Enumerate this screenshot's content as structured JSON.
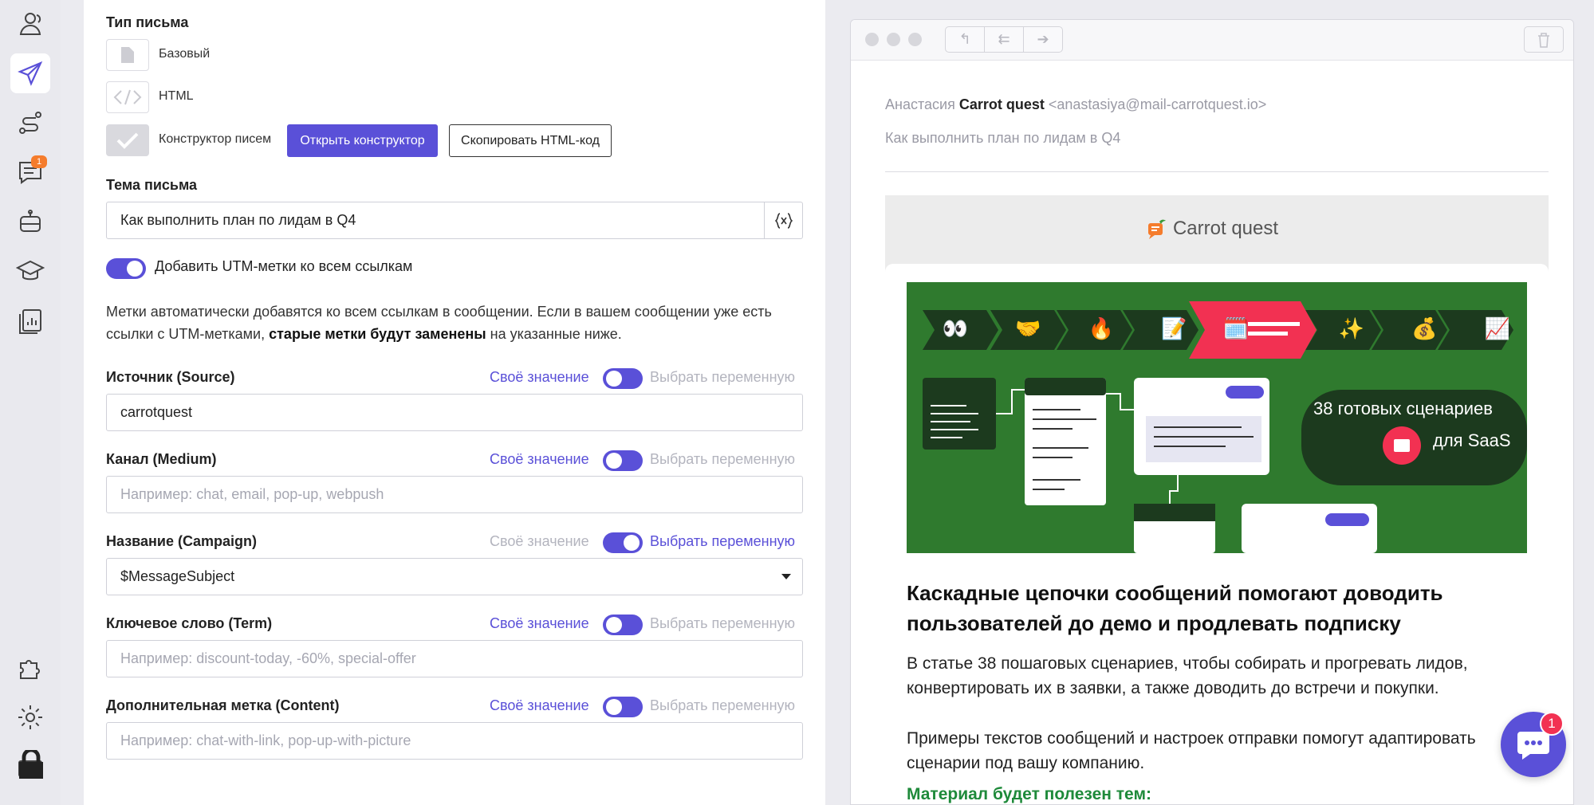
{
  "sidebar": {
    "messages_badge": "1"
  },
  "form": {
    "type_label": "Тип письма",
    "type_basic": "Базовый",
    "type_html": "HTML",
    "type_builder": "Конструктор писем",
    "open_builder": "Открыть конструктор",
    "copy_html": "Скопировать HTML-код",
    "subject_label": "Тема письма",
    "subject_value": "Как выполнить план по лидам в Q4",
    "utm_toggle_label": "Добавить UTM-метки ко всем ссылкам",
    "desc_part1": "Метки автоматически добавятся ко всем ссылкам в сообщении. Если в вашем сообщении уже есть ссылки с UTM-метками, ",
    "desc_bold": "старые метки будут заменены",
    "desc_part2": " на указанные ниже.",
    "own_value": "Своё значение",
    "choose_var": "Выбрать переменную",
    "source_label": "Источник (Source)",
    "source_value": "carrotquest",
    "medium_label": "Канал (Medium)",
    "medium_placeholder": "Например: chat, email, pop-up, webpush",
    "campaign_label": "Название (Campaign)",
    "campaign_value": "$MessageSubject",
    "term_label": "Ключевое слово (Term)",
    "term_placeholder": "Например: discount-today, -60%, special-offer",
    "content_label": "Дополнительная метка (Content)",
    "content_placeholder": "Например: chat-with-link, pop-up-with-picture"
  },
  "preview": {
    "from_first": "Анастасия",
    "from_last": "Carrot quest",
    "from_email": "<anastasiya@mail-carrotquest.io>",
    "subject": "Как выполнить план по лидам в Q4",
    "brand": "Carrot quest",
    "banner_text1": "38 готовых сценариев",
    "banner_text2": "для SaaS",
    "banner_emojis": [
      "👀",
      "🤝",
      "🔥",
      "📝",
      "🗓️",
      "✨",
      "💰",
      "📈"
    ],
    "heading": "Каскадные цепочки сообщений помогают доводить пользователей до демо и продлевать подписку",
    "para1": "В статье 38 пошаговых сценариев, чтобы собирать и прогревать лидов, конвертировать их в заявки, а также доводить до встречи и покупки.",
    "para2": "Примеры текстов сообщений и настроек отправки помогут адаптировать сценарии под вашу компанию.",
    "useful_for": "Материал будет полезен тем:"
  },
  "chat_badge": "1",
  "colors": {
    "accent": "#5a50d8",
    "badge_orange": "#f57c2c",
    "badge_red": "#f23152",
    "banner_green": "#2f7a2e",
    "text_green": "#1e8a3a"
  }
}
